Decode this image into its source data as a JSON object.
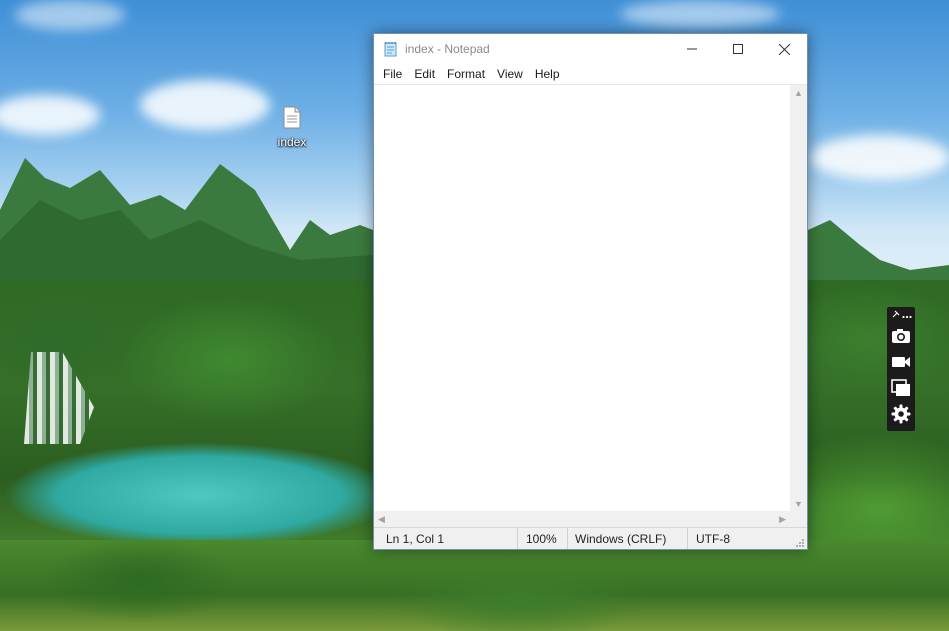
{
  "desktop": {
    "icons": [
      {
        "label": "index",
        "icon": "text-file-icon"
      }
    ]
  },
  "notepad": {
    "title": "index - Notepad",
    "app_icon": "notepad-icon",
    "menu": [
      "File",
      "Edit",
      "Format",
      "View",
      "Help"
    ],
    "content": "",
    "status": {
      "position": "Ln 1, Col 1",
      "zoom": "100%",
      "line_ending": "Windows (CRLF)",
      "encoding": "UTF-8"
    }
  },
  "capture_toolbar": {
    "buttons": [
      "screenshot-camera-icon",
      "video-record-icon",
      "window-capture-icon",
      "settings-gear-icon"
    ]
  },
  "colors": {
    "window_border": "#6f8fb3",
    "statusbar_bg": "#f0f0f0",
    "toolbar_bg": "#1b1b1b"
  }
}
